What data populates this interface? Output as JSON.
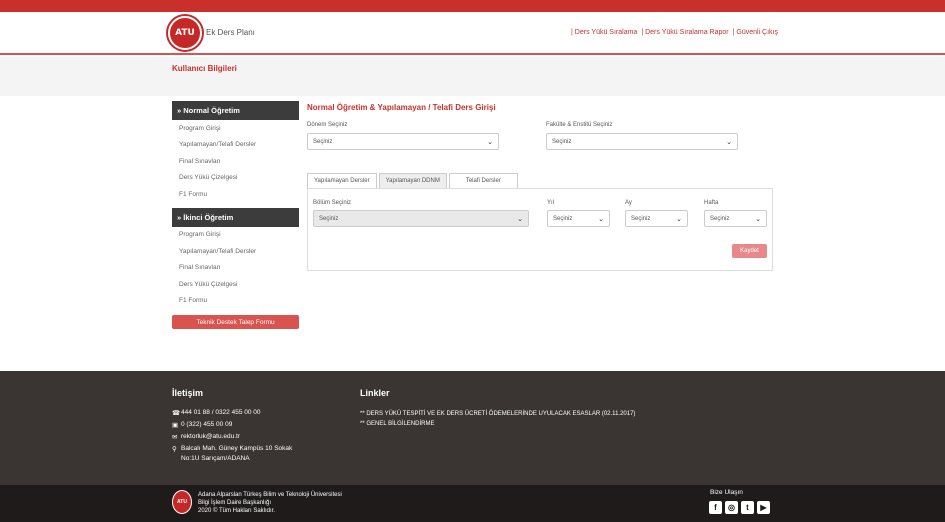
{
  "header": {
    "logo_text": "ATU",
    "app_title": "Ek Ders Planı",
    "nav": [
      {
        "label": "| Ders Yükü Sıralama"
      },
      {
        "label": "| Ders Yükü Sıralama Rapor"
      },
      {
        "label": "| Güvenli Çıkış"
      }
    ]
  },
  "subheader": {
    "title": "Kullanıcı Bilgileri"
  },
  "sidebar": {
    "normal_title": "» Normal Öğretim",
    "normal_items": [
      "Program Girişi",
      "Yapılamayan/Telafi Dersler",
      "Final Sınavları",
      "Ders Yükü Çizelgesi",
      "F1 Formu"
    ],
    "second_title": "» İkinci Öğretim",
    "second_items": [
      "Program Girişi",
      "Yapılamayan/Telafi Dersler",
      "Final Sınavları",
      "Ders Yükü Çizelgesi",
      "F1 Formu"
    ],
    "support_label": "Teknik Destek Talep Formu"
  },
  "main": {
    "title": "Normal Öğretim & Yapılamayan / Telafi Ders Girişi",
    "term_label": "Dönem Seçiniz",
    "term_value": "Seçiniz",
    "faculty_label": "Fakülte & Enstitü Seçiniz",
    "faculty_value": "Seçiniz",
    "tabs": [
      "Yapılamayan Dersler",
      "Yapılamayan DDNM",
      "Telafi Dersler"
    ],
    "dept_label": "Bölüm Seçiniz",
    "dept_value": "Seçiniz",
    "year_label": "Yıl",
    "year_value": "Seçiniz",
    "month_label": "Ay",
    "month_value": "Seçiniz",
    "week_label": "Hafta",
    "week_value": "Seçiniz",
    "save_label": "Kaydet"
  },
  "footer": {
    "contact_title": "İletişim",
    "phone": "444 01 88  / 0322 455 00 00",
    "fax": "0 (322) 455 00 09",
    "email": "rektorluk@atu.edu.tr",
    "address1": "Balcalı Mah. Güney Kampüs 10 Sokak",
    "address2": "No:1U Sarıçam/ADANA",
    "links_title": "Linkler",
    "links": [
      "** DERS YÜKÜ TESPİTİ VE EK DERS ÜCRETİ ÖDEMELERİNDE UYULACAK ESASLAR (02.11.2017)",
      "** GENEL BİLGİLENDİRME"
    ]
  },
  "bottom": {
    "logo_text": "ATU",
    "line1": "Adana Alparslan Türkeş Bilim ve Teknoloji Üniversitesi",
    "line2": "Bilgi İşlem Daire Başkanlığı",
    "line3": "2020 © Tüm Hakları Saklıdır.",
    "follow": "Bize Ulaşın",
    "socials": [
      "f",
      "◎",
      "t",
      "▶"
    ]
  },
  "colors": {
    "brand": "#c9302c",
    "footer": "#3a3433",
    "bottom": "#1f1b1b"
  }
}
